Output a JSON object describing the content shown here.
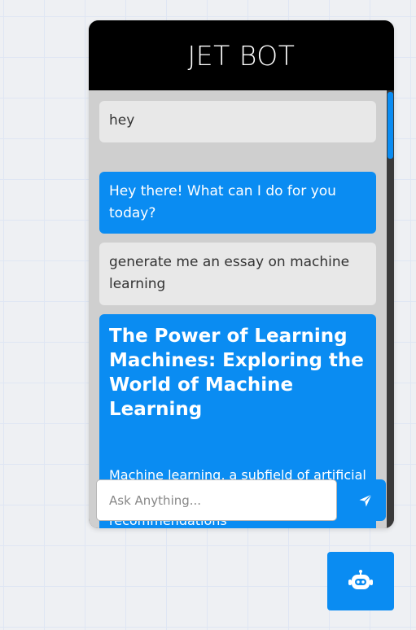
{
  "chat": {
    "title": "JET BOT",
    "messages": [
      {
        "role": "user",
        "text": "hey"
      },
      {
        "role": "bot",
        "text": "Hey there! What can I do for you today?"
      },
      {
        "role": "user",
        "text": "generate me an essay on machine learning"
      },
      {
        "role": "bot",
        "title": "The Power of Learning Machines: Exploring the World of Machine Learning",
        "text": "Machine learning, a subfield of artificial intelligence, ... From personalized recommendations"
      }
    ],
    "input": {
      "placeholder": "Ask Anything...",
      "value": ""
    },
    "send_icon": "send-icon",
    "launcher_icon": "robot-icon"
  },
  "colors": {
    "accent": "#0a8cf2",
    "header": "#000000",
    "user_bubble": "#e8e8e8",
    "background": "#eef0f3"
  }
}
